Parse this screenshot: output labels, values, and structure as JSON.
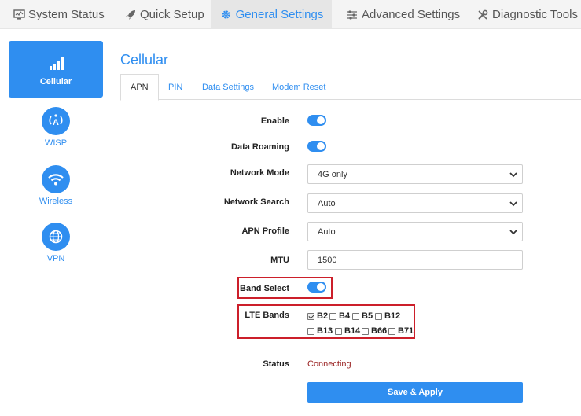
{
  "topnav": {
    "tabs": [
      {
        "label": "System Status",
        "icon": "monitor-icon"
      },
      {
        "label": "Quick Setup",
        "icon": "rocket-icon"
      },
      {
        "label": "General Settings",
        "icon": "gear-icon"
      },
      {
        "label": "Advanced Settings",
        "icon": "sliders-icon"
      },
      {
        "label": "Diagnostic Tools",
        "icon": "tools-icon"
      }
    ],
    "active_index": 2
  },
  "sidenav": {
    "items": [
      {
        "label": "Cellular",
        "icon": "signal-bars-icon"
      },
      {
        "label": "WISP",
        "icon": "antenna-icon"
      },
      {
        "label": "Wireless",
        "icon": "wifi-icon"
      },
      {
        "label": "VPN",
        "icon": "globe-icon"
      }
    ],
    "active_index": 0
  },
  "page": {
    "title": "Cellular",
    "subtabs": [
      "APN",
      "PIN",
      "Data Settings",
      "Modem Reset"
    ],
    "active_subtab": 0
  },
  "form": {
    "enable_label": "Enable",
    "data_roaming_label": "Data Roaming",
    "network_mode_label": "Network Mode",
    "network_mode_value": "4G only",
    "network_search_label": "Network Search",
    "network_search_value": "Auto",
    "apn_profile_label": "APN Profile",
    "apn_profile_value": "Auto",
    "mtu_label": "MTU",
    "mtu_value": "1500",
    "band_select_label": "Band Select",
    "lte_bands_label": "LTE Bands",
    "lte_bands": [
      {
        "label": "B2",
        "checked": true
      },
      {
        "label": "B4",
        "checked": false
      },
      {
        "label": "B5",
        "checked": false
      },
      {
        "label": "B12",
        "checked": false
      },
      {
        "label": "B13",
        "checked": false
      },
      {
        "label": "B14",
        "checked": false
      },
      {
        "label": "B66",
        "checked": false
      },
      {
        "label": "B71",
        "checked": false
      }
    ],
    "status_label": "Status",
    "status_value": "Connecting",
    "apply_label": "Save & Apply"
  },
  "colors": {
    "accent": "#2f8ef0",
    "highlight_box": "#cc1f2a",
    "status_text": "#9b2424"
  }
}
